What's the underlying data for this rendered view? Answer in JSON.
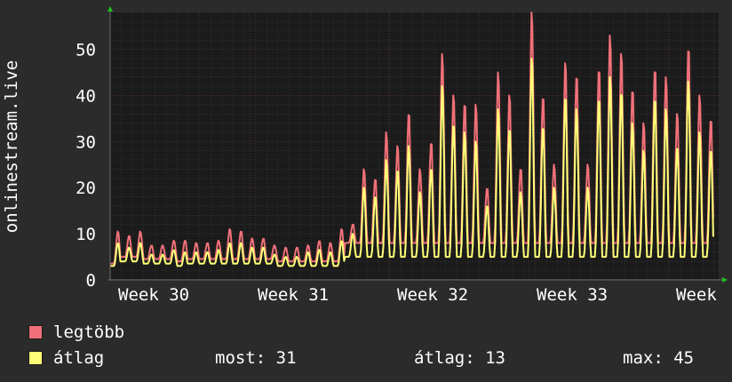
{
  "chart_data": {
    "type": "line",
    "ylabel": "onlinestream.live",
    "ylim": [
      0,
      58
    ],
    "yticks": [
      0,
      10,
      20,
      30,
      40,
      50
    ],
    "xticks": [
      "Week 30",
      "Week 31",
      "Week 32",
      "Week 33",
      "Week"
    ],
    "grid": true,
    "legend_placement": "bottom-left",
    "colors": {
      "background": "#2b2b2b",
      "plot": "#1b1b1b",
      "grid": "#454545",
      "axis": "#6b6b6b",
      "arrow": "#20c020",
      "max": "#f07079",
      "avg": "#ffff77"
    },
    "series": [
      {
        "name": "legtöbb",
        "color": "#f07079",
        "day_peaks": [
          10.5,
          9.5,
          10.5,
          7.5,
          7.5,
          8.5,
          8.5,
          8,
          8,
          8.5,
          11,
          10.5,
          9,
          9,
          7.5,
          7,
          7,
          7.5,
          8.5,
          8,
          11,
          12,
          24,
          22,
          32,
          29,
          36,
          24,
          30,
          49,
          40,
          38,
          38,
          20,
          45,
          40,
          24,
          58,
          40,
          25,
          47,
          44,
          25,
          46,
          53,
          49,
          41,
          34,
          46,
          44,
          36,
          50,
          40,
          35
        ],
        "day_troughs": [
          3.5,
          5,
          5,
          4.5,
          4.5,
          4.5,
          4,
          4.5,
          4.5,
          4.5,
          4.5,
          4.5,
          4.5,
          4.5,
          4.5,
          4,
          4,
          4,
          4,
          4,
          4,
          8,
          8,
          8,
          8,
          8,
          8,
          8,
          8,
          8,
          8,
          8,
          8,
          8,
          8,
          8,
          8,
          8,
          8,
          8,
          8,
          8,
          8,
          8,
          8,
          8,
          8,
          8,
          8,
          8,
          8,
          8,
          8,
          8,
          8
        ]
      },
      {
        "name": "átlag",
        "color": "#ffff77",
        "day_peaks": [
          8,
          7,
          8,
          5.5,
          5.5,
          6.5,
          6,
          6,
          6,
          6.5,
          8,
          8,
          7,
          7,
          5.5,
          5,
          5,
          6,
          6.5,
          6,
          8.5,
          10,
          20,
          18,
          26,
          24,
          29,
          19,
          24,
          42,
          34,
          32,
          30,
          16,
          37,
          33,
          19,
          48,
          33,
          20,
          40,
          37,
          20,
          39,
          44,
          41,
          34,
          28,
          39,
          37,
          29,
          43,
          32,
          28
        ],
        "day_troughs": [
          3,
          4,
          4,
          3.5,
          3.5,
          3.5,
          3,
          3.5,
          3.5,
          3.5,
          3.5,
          3.5,
          3.5,
          3.5,
          3.5,
          3,
          3,
          3,
          3,
          3,
          3,
          5,
          5,
          5,
          5,
          5,
          5,
          5,
          5,
          5,
          5,
          5,
          5,
          5,
          5,
          5,
          5,
          5,
          5,
          5,
          5,
          5,
          5,
          5,
          5,
          5,
          5,
          5,
          5,
          5,
          5,
          5,
          5,
          5,
          5
        ]
      }
    ]
  },
  "legend": {
    "max_label": "legtöbb",
    "avg_label": "átlag",
    "max_color": "#f07079",
    "avg_color": "#ffff77"
  },
  "stats": {
    "now": "most: 31",
    "avg": "átlag: 13",
    "max": "max: 45"
  }
}
